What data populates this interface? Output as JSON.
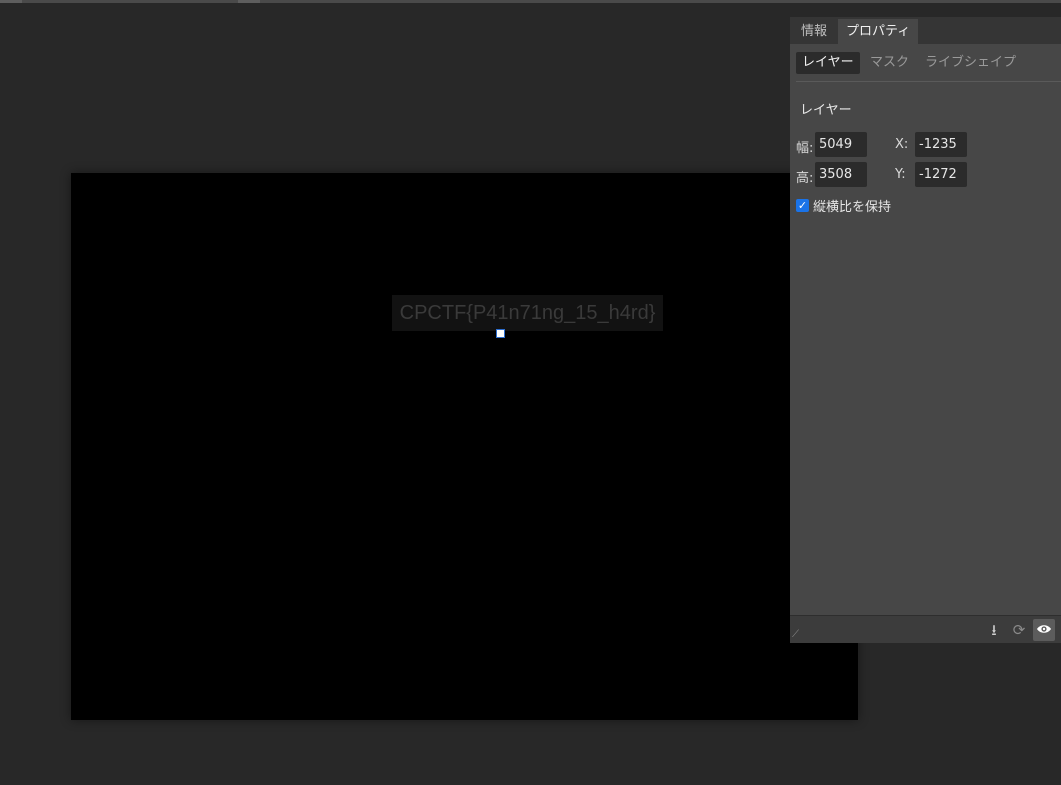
{
  "canvas": {
    "text_layer": "CPCTF{P41n71ng_15_h4rd}"
  },
  "panel": {
    "tabs": [
      {
        "label": "情報",
        "active": false
      },
      {
        "label": "プロパティ",
        "active": true
      }
    ],
    "subtabs": [
      {
        "label": "レイヤー",
        "active": true
      },
      {
        "label": "マスク",
        "active": false
      },
      {
        "label": "ライブシェイプ",
        "active": false
      }
    ],
    "section_title": "レイヤー",
    "fields": {
      "width_label": "幅:",
      "width_value": "5049",
      "height_label": "高:",
      "height_value": "3508",
      "x_label": "X:",
      "x_value": "-1235",
      "y_label": "Y:",
      "y_value": "-1272"
    },
    "keep_ratio": {
      "label": "縦横比を保持",
      "checked": true
    },
    "footer_icons": [
      "apply-down-icon",
      "refresh-icon",
      "eye-icon"
    ]
  },
  "colors": {
    "workspace_bg": "#282828",
    "panel_bg": "#474747",
    "accent": "#1a73e8",
    "canvas_bg": "#000000"
  }
}
